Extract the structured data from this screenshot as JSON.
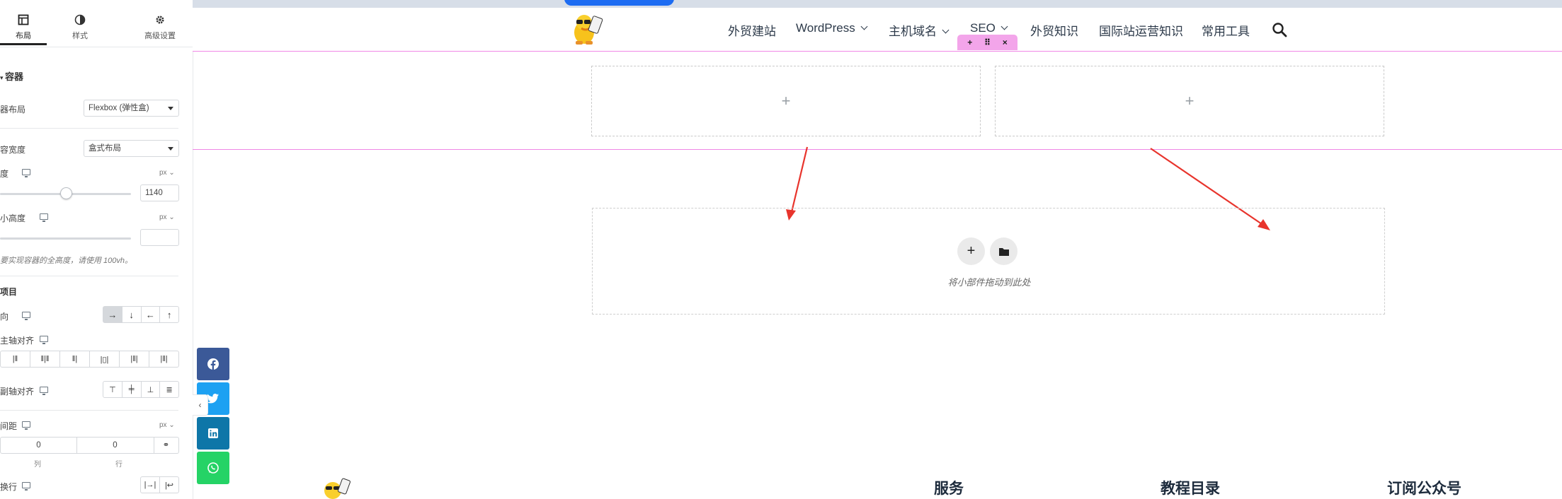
{
  "panel": {
    "tabs": [
      {
        "label": "布局",
        "icon": "layout-icon"
      },
      {
        "label": "样式",
        "icon": "contrast-icon"
      },
      {
        "label": "高级设置",
        "icon": "gear-icon"
      }
    ],
    "section_title": "容器",
    "container_layout": {
      "label": "器布局",
      "value": "Flexbox (弹性盒)"
    },
    "content_width": {
      "label": "容宽度",
      "value": "盒式布局"
    },
    "width": {
      "label": "度",
      "unit": "px",
      "value": "1140",
      "slider_fraction": 0.5
    },
    "min_height": {
      "label": "小高度",
      "unit": "px",
      "value": ""
    },
    "hint": "要实现容器的全高度，请使用 100vh。",
    "items_title": "项目",
    "direction": {
      "label": "向",
      "options": [
        "→",
        "↓",
        "←",
        "↑"
      ],
      "selected": 0
    },
    "justify": {
      "label": "主轴对齐"
    },
    "align": {
      "label": "副轴对齐"
    },
    "gap": {
      "label": "间距",
      "unit": "px",
      "column": "0",
      "row": "0",
      "column_label": "列",
      "row_label": "行"
    },
    "wrap": {
      "label": "换行"
    }
  },
  "nav": {
    "items": [
      {
        "label": "外贸建站",
        "dropdown": false
      },
      {
        "label": "WordPress",
        "dropdown": true
      },
      {
        "label": "主机域名",
        "dropdown": true
      },
      {
        "label": "SEO",
        "dropdown": true
      },
      {
        "label": "外贸知识",
        "dropdown": false
      },
      {
        "label": "国际站运营知识",
        "dropdown": false
      },
      {
        "label": "常用工具",
        "dropdown": false
      }
    ]
  },
  "section_handle": {
    "add": "+",
    "drag": "⠿",
    "close": "×"
  },
  "columns": [
    {
      "placeholder": "+"
    },
    {
      "placeholder": "+"
    }
  ],
  "drop_zone": {
    "text": "将小部件拖动到此处",
    "add": "+",
    "colors": {
      "accent": "#eaeaea"
    }
  },
  "share": [
    {
      "name": "facebook",
      "color": "#3b5998"
    },
    {
      "name": "twitter",
      "color": "#1da1f2"
    },
    {
      "name": "linkedin",
      "color": "#0e76a8"
    },
    {
      "name": "whatsapp",
      "color": "#25d366"
    }
  ],
  "footer": {
    "titles": [
      "服务",
      "教程目录",
      "订阅公众号"
    ]
  },
  "colors": {
    "section_outline": "#f087e6",
    "arrow": "#e8342c",
    "topbar": "#d7dee8",
    "brand_blue": "#1d6cf2"
  }
}
